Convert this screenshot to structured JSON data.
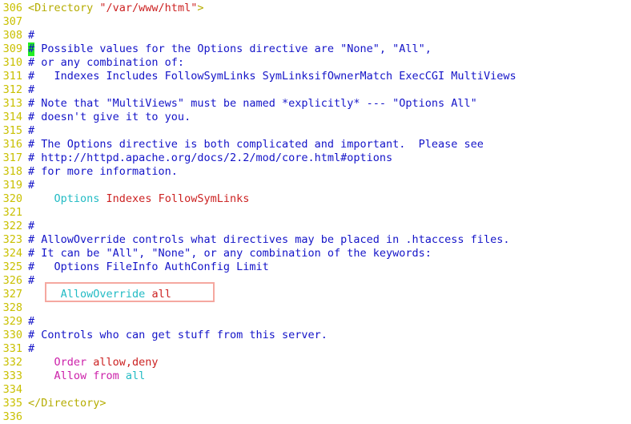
{
  "editor": {
    "title": "Apache httpd.conf Directory block",
    "font_size_px": 13.5,
    "line_height_px": 17,
    "colors": {
      "background": "#ffffff",
      "line_number": "#c9c000",
      "comment": "#1414c8",
      "tag": "#b5ac00",
      "string": "#cc2222",
      "directive": "#22bbc4",
      "keyword": "#cc22aa",
      "cursor_highlight": "#22ee22",
      "focus_box_border": "#f5a8a0"
    },
    "cursor": {
      "line": "309",
      "character": "#",
      "highlight_color": "#22ee22"
    },
    "focus_box": {
      "line": "327",
      "text": "AllowOverride all",
      "border_color": "#f5a8a0"
    }
  },
  "lines": [
    {
      "no": "306",
      "tokens": [
        {
          "t": "<Directory ",
          "c": "tag"
        },
        {
          "t": "\"/var/www/html\"",
          "c": "string"
        },
        {
          "t": ">",
          "c": "tag"
        }
      ]
    },
    {
      "no": "307",
      "tokens": []
    },
    {
      "no": "308",
      "tokens": [
        {
          "t": "#",
          "c": "hash"
        }
      ]
    },
    {
      "no": "309",
      "cursor": true,
      "tokens": [
        {
          "t": "#",
          "c": "cursor"
        },
        {
          "t": " Possible values for the Options directive are \"None\", \"All\",",
          "c": "comment"
        }
      ]
    },
    {
      "no": "310",
      "tokens": [
        {
          "t": "# or any combination of:",
          "c": "comment"
        }
      ]
    },
    {
      "no": "311",
      "tokens": [
        {
          "t": "#   Indexes Includes FollowSymLinks SymLinksifOwnerMatch ExecCGI MultiViews",
          "c": "comment"
        }
      ]
    },
    {
      "no": "312",
      "tokens": [
        {
          "t": "#",
          "c": "hash"
        }
      ]
    },
    {
      "no": "313",
      "tokens": [
        {
          "t": "# Note that \"MultiViews\" must be named *explicitly* --- \"Options All\"",
          "c": "comment"
        }
      ]
    },
    {
      "no": "314",
      "tokens": [
        {
          "t": "# doesn't give it to you.",
          "c": "comment"
        }
      ]
    },
    {
      "no": "315",
      "tokens": [
        {
          "t": "#",
          "c": "hash"
        }
      ]
    },
    {
      "no": "316",
      "tokens": [
        {
          "t": "# The Options directive is both complicated and important.  Please see",
          "c": "comment"
        }
      ]
    },
    {
      "no": "317",
      "tokens": [
        {
          "t": "# http://httpd.apache.org/docs/2.2/mod/core.html#options",
          "c": "comment"
        }
      ]
    },
    {
      "no": "318",
      "tokens": [
        {
          "t": "# for more information.",
          "c": "comment"
        }
      ]
    },
    {
      "no": "319",
      "tokens": [
        {
          "t": "#",
          "c": "hash"
        }
      ]
    },
    {
      "no": "320",
      "tokens": [
        {
          "t": "    Options ",
          "c": "directive"
        },
        {
          "t": "Indexes FollowSymLinks",
          "c": "string"
        }
      ]
    },
    {
      "no": "321",
      "tokens": []
    },
    {
      "no": "322",
      "tokens": [
        {
          "t": "#",
          "c": "hash"
        }
      ]
    },
    {
      "no": "323",
      "tokens": [
        {
          "t": "# AllowOverride controls what directives may be placed in .htaccess files.",
          "c": "comment"
        }
      ]
    },
    {
      "no": "324",
      "tokens": [
        {
          "t": "# It can be \"All\", \"None\", or any combination of the keywords:",
          "c": "comment"
        }
      ]
    },
    {
      "no": "325",
      "tokens": [
        {
          "t": "#   Options FileInfo AuthConfig Limit",
          "c": "comment"
        }
      ]
    },
    {
      "no": "326",
      "tokens": [
        {
          "t": "#",
          "c": "hash"
        }
      ]
    },
    {
      "no": "327",
      "boxed": true,
      "tokens": [
        {
          "t": "     AllowOverride ",
          "c": "directive"
        },
        {
          "t": "all",
          "c": "string"
        }
      ]
    },
    {
      "no": "328",
      "tokens": []
    },
    {
      "no": "329",
      "tokens": [
        {
          "t": "#",
          "c": "hash"
        }
      ]
    },
    {
      "no": "330",
      "tokens": [
        {
          "t": "# Controls who can get stuff from this server.",
          "c": "comment"
        }
      ]
    },
    {
      "no": "331",
      "tokens": [
        {
          "t": "#",
          "c": "hash"
        }
      ]
    },
    {
      "no": "332",
      "tokens": [
        {
          "t": "    Order ",
          "c": "keyword"
        },
        {
          "t": "allow,deny",
          "c": "string"
        }
      ]
    },
    {
      "no": "333",
      "tokens": [
        {
          "t": "    Allow from ",
          "c": "keyword"
        },
        {
          "t": "all",
          "c": "cyanarg"
        }
      ]
    },
    {
      "no": "334",
      "tokens": []
    },
    {
      "no": "335",
      "tokens": [
        {
          "t": "</Directory>",
          "c": "tag"
        }
      ]
    },
    {
      "no": "336",
      "tokens": []
    }
  ]
}
